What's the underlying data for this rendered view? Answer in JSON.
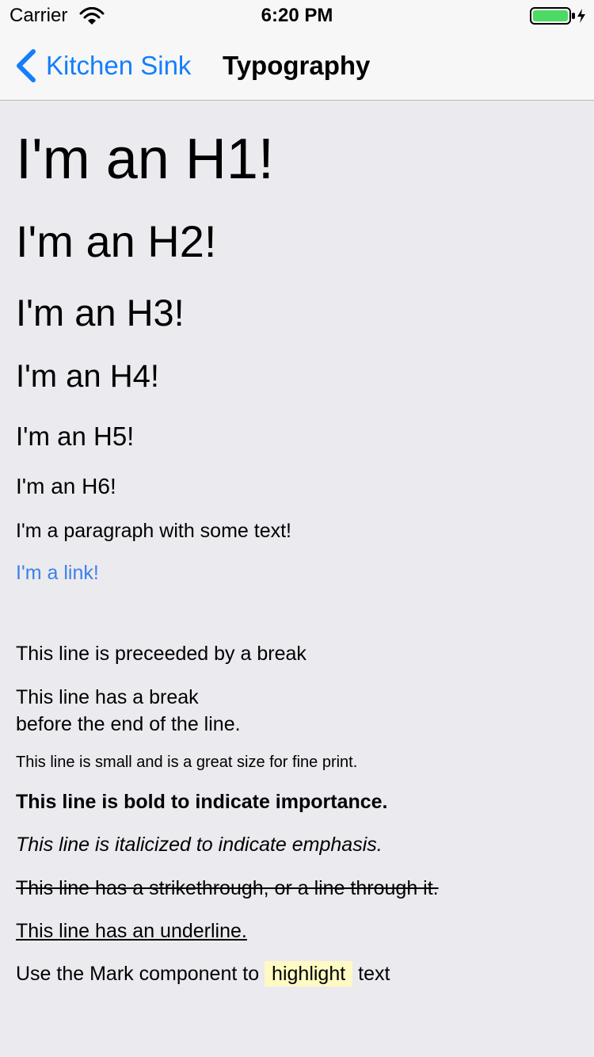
{
  "status_bar": {
    "carrier": "Carrier",
    "time": "6:20 PM",
    "battery_color": "#4cd964"
  },
  "navigation": {
    "back_label": "Kitchen Sink",
    "title": "Typography",
    "accent_color": "#157efb"
  },
  "typography": {
    "h1": "I'm an H1!",
    "h2": "I'm an H2!",
    "h3": "I'm an H3!",
    "h4": "I'm an H4!",
    "h5": "I'm an H5!",
    "h6": "I'm an H6!",
    "paragraph": "I'm a paragraph with some text!",
    "link": "I'm a link!",
    "break_line": "This line is preceeded by a break",
    "line_break_first": "This line has a break",
    "line_break_second": "before the end of the line.",
    "small": "This line is small and is a great size for fine print.",
    "bold": "This line is bold to indicate importance.",
    "italic": "This line is italicized to indicate emphasis.",
    "strike": "This line has a strikethrough, or a line through it.",
    "underline": "This line has an underline.",
    "mark_prefix": "Use the Mark component to",
    "mark_highlight": "highlight",
    "mark_suffix": "text"
  },
  "colors": {
    "link": "#3c81e8",
    "highlight": "#fff9c4"
  }
}
